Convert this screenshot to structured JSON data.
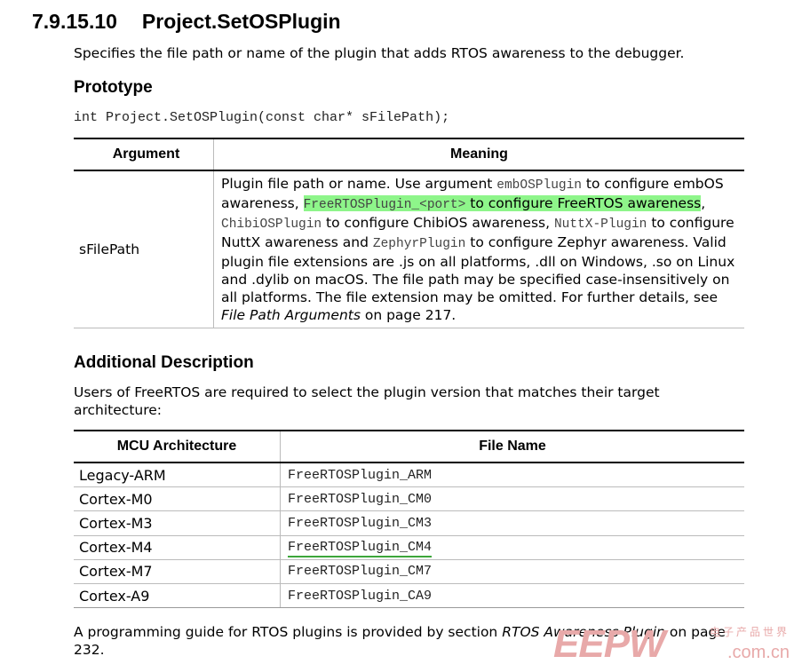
{
  "section": {
    "number": "7.9.15.10",
    "title": "Project.SetOSPlugin",
    "description": "Specifies the file path or name of the plugin that adds RTOS awareness to the debugger."
  },
  "prototype": {
    "heading": "Prototype",
    "code": "int Project.SetOSPlugin(const char* sFilePath);"
  },
  "arguments_table": {
    "headers": [
      "Argument",
      "Meaning"
    ],
    "row": {
      "argument": "sFilePath",
      "t1": "Plugin file path or name. Use argument ",
      "c1": "embOSPlugin",
      "t2": " to configure embOS awareness, ",
      "c2": "FreeRTOSPlugin_<port>",
      "t3": " to configure FreeRTOS awareness",
      "t4": ", ",
      "c3": "ChibiOSPlugin",
      "t5": " to configure ChibiOS awareness, ",
      "c4": "NuttX-Plugin",
      "t6": " to configure NuttX awareness and ",
      "c5": "ZephyrPlugin",
      "t7": " to configure Zephyr awareness. Valid plugin file extensions are .js on all platforms, .dll on Windows, .so on Linux and .dylib on macOS. The file path may be specified case-insensitively on all platforms. The file extension may be omitted. For further details, see ",
      "ref": "File Path Arguments",
      "t8": " on page 217."
    }
  },
  "additional": {
    "heading": "Additional Description",
    "text": "Users of FreeRTOS are required to select the plugin version that matches their target architecture:"
  },
  "arch_table": {
    "headers": [
      "MCU Architecture",
      "File Name"
    ],
    "rows": [
      {
        "arch": "Legacy-ARM",
        "file": "FreeRTOSPlugin_ARM"
      },
      {
        "arch": "Cortex-M0",
        "file": "FreeRTOSPlugin_CM0"
      },
      {
        "arch": "Cortex-M3",
        "file": "FreeRTOSPlugin_CM3"
      },
      {
        "arch": "Cortex-M4",
        "file": "FreeRTOSPlugin_CM4"
      },
      {
        "arch": "Cortex-M7",
        "file": "FreeRTOSPlugin_CM7"
      },
      {
        "arch": "Cortex-A9",
        "file": "FreeRTOSPlugin_CA9"
      }
    ]
  },
  "footer": {
    "t1": "A programming guide for RTOS plugins is provided by section ",
    "ref": "RTOS Awareness Plugin",
    "t2": " on page 232."
  },
  "watermark": {
    "big": "EEPW",
    "small": ".com.cn",
    "top": "电子产品世界"
  },
  "colors": {
    "highlight": "#8ef58a",
    "underline": "#3da63a",
    "watermark": "#e8a9a9"
  }
}
